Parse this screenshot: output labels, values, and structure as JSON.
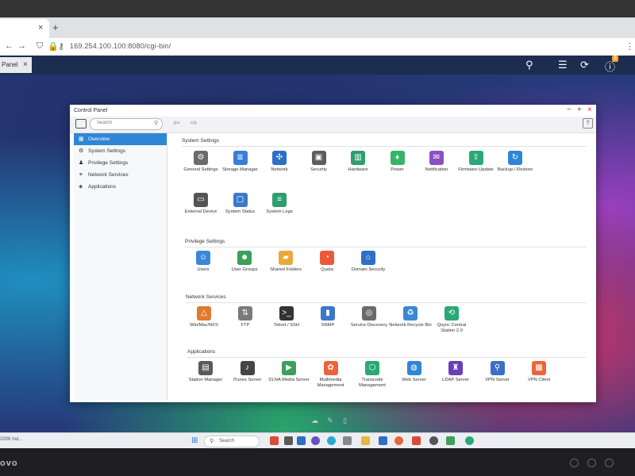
{
  "browser": {
    "tab_close": "×",
    "new_tab": "+",
    "url": "169.254.100.100:8080/cgi-bin/"
  },
  "qts": {
    "tab_label": "Panel",
    "tab_close": "×",
    "notification_count": "8"
  },
  "control_panel": {
    "title": "Control Panel",
    "search_placeholder": "Search",
    "help": "?",
    "sidebar": [
      {
        "label": "Overview",
        "icon": "overview-icon",
        "active": true
      },
      {
        "label": "System Settings",
        "icon": "system-settings-icon"
      },
      {
        "label": "Privilege Settings",
        "icon": "user-icon"
      },
      {
        "label": "Network Services",
        "icon": "network-icon"
      },
      {
        "label": "Applications",
        "icon": "applications-icon"
      }
    ],
    "sections": {
      "system_settings": {
        "title": "System Settings",
        "items": [
          {
            "label": "General Settings",
            "icon": "gear-icon",
            "color": "#6b6b6b"
          },
          {
            "label": "Storage Manager",
            "icon": "database-icon",
            "color": "#3b7dd8"
          },
          {
            "label": "Network",
            "icon": "network-icon",
            "color": "#2c6fc7"
          },
          {
            "label": "Security",
            "icon": "lock-icon",
            "color": "#5c5c5c"
          },
          {
            "label": "Hardware",
            "icon": "chip-icon",
            "color": "#2f9e6e"
          },
          {
            "label": "Power",
            "icon": "bulb-icon",
            "color": "#35b56a"
          },
          {
            "label": "Notification",
            "icon": "notification-icon",
            "color": "#8a4fc5"
          },
          {
            "label": "Firmware Update",
            "icon": "firmware-icon",
            "color": "#2aa876"
          },
          {
            "label": "Backup / Restore",
            "icon": "backup-icon",
            "color": "#2f86d6"
          },
          {
            "label": "External Device",
            "icon": "drive-icon",
            "color": "#555555"
          },
          {
            "label": "System Status",
            "icon": "monitor-icon",
            "color": "#3a78c9"
          },
          {
            "label": "System Logs",
            "icon": "log-icon",
            "color": "#2f9e6e"
          }
        ]
      },
      "privilege_settings": {
        "title": "Privilege Settings",
        "items": [
          {
            "label": "Users",
            "icon": "user-icon",
            "color": "#3a88d6"
          },
          {
            "label": "User Groups",
            "icon": "user-group-icon",
            "color": "#3aa05a"
          },
          {
            "label": "Shared Folders",
            "icon": "folder-icon",
            "color": "#e8a83a"
          },
          {
            "label": "Quota",
            "icon": "pie-icon",
            "color": "#e85a3a"
          },
          {
            "label": "Domain Security",
            "icon": "domain-icon",
            "color": "#2f6fc5"
          }
        ]
      },
      "network_services": {
        "title": "Network Services",
        "items": [
          {
            "label": "Win/Mac/NFS",
            "icon": "triangle-icon",
            "color": "#e07a2e"
          },
          {
            "label": "FTP",
            "icon": "ftp-icon",
            "color": "#7a7a7a"
          },
          {
            "label": "Telnet / SSH",
            "icon": "terminal-icon",
            "color": "#333333"
          },
          {
            "label": "SNMP",
            "icon": "bar-chart-icon",
            "color": "#3a78c9"
          },
          {
            "label": "Service Discovery",
            "icon": "discovery-icon",
            "color": "#6a6a6a"
          },
          {
            "label": "Network Recycle Bin",
            "icon": "recycle-bin-icon",
            "color": "#3a88d6"
          },
          {
            "label": "Qsync Central Station 2.0",
            "icon": "sync-icon",
            "color": "#2aa876"
          }
        ]
      },
      "applications": {
        "title": "Applications",
        "items": [
          {
            "label": "Station Manager",
            "icon": "station-icon",
            "color": "#5a5a5a"
          },
          {
            "label": "iTunes Server",
            "icon": "itunes-icon",
            "color": "#444444"
          },
          {
            "label": "DLNA Media Server",
            "icon": "media-icon",
            "color": "#3aa05a"
          },
          {
            "label": "Multimedia Management",
            "icon": "multimedia-icon",
            "color": "#e8673a"
          },
          {
            "label": "Transcode Management",
            "icon": "transcode-icon",
            "color": "#2aa876"
          },
          {
            "label": "Web Server",
            "icon": "globe-icon",
            "color": "#2f86d6"
          },
          {
            "label": "LDAP Server",
            "icon": "ldap-icon",
            "color": "#6a3fb5"
          },
          {
            "label": "VPN Server",
            "icon": "vpn-icon",
            "color": "#3a6fc5"
          },
          {
            "label": "VPN Client",
            "icon": "briefcase-icon",
            "color": "#e8673a"
          }
        ]
      }
    }
  },
  "taskbar": {
    "left_text": "2006 Ind...",
    "search_label": "Search"
  },
  "monitor": {
    "brand": "ovo"
  }
}
